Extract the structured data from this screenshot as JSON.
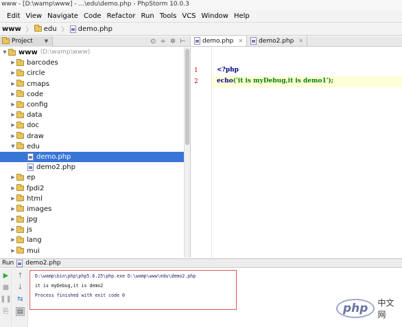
{
  "window": {
    "title": "www - [D:\\wamp\\www] - ...\\edu\\demo.php - PhpStorm 10.0.3"
  },
  "menu": [
    "Edit",
    "View",
    "Navigate",
    "Code",
    "Refactor",
    "Run",
    "Tools",
    "VCS",
    "Window",
    "Help"
  ],
  "breadcrumb": {
    "root": "www",
    "folder": "edu",
    "file": "demo.php"
  },
  "project_panel": {
    "tab_label": "Project",
    "root_label": "www",
    "root_hint": "(D:\\wamp\\www)",
    "items": [
      {
        "label": "barcodes",
        "kind": "folder",
        "state": "collapsed"
      },
      {
        "label": "circle",
        "kind": "folder",
        "state": "collapsed"
      },
      {
        "label": "cmaps",
        "kind": "folder",
        "state": "collapsed"
      },
      {
        "label": "code",
        "kind": "folder",
        "state": "collapsed"
      },
      {
        "label": "config",
        "kind": "folder",
        "state": "collapsed"
      },
      {
        "label": "data",
        "kind": "folder",
        "state": "collapsed"
      },
      {
        "label": "doc",
        "kind": "folder",
        "state": "collapsed"
      },
      {
        "label": "draw",
        "kind": "folder",
        "state": "collapsed"
      },
      {
        "label": "edu",
        "kind": "folder",
        "state": "expanded"
      },
      {
        "label": "demo.php",
        "kind": "php",
        "state": "selected"
      },
      {
        "label": "demo2.php",
        "kind": "php",
        "state": ""
      },
      {
        "label": "ep",
        "kind": "folder",
        "state": "collapsed"
      },
      {
        "label": "fpdi2",
        "kind": "folder",
        "state": "collapsed"
      },
      {
        "label": "html",
        "kind": "folder",
        "state": "collapsed"
      },
      {
        "label": "images",
        "kind": "folder",
        "state": "collapsed"
      },
      {
        "label": "jpg",
        "kind": "folder",
        "state": "collapsed"
      },
      {
        "label": "js",
        "kind": "folder",
        "state": "collapsed"
      },
      {
        "label": "lang",
        "kind": "folder",
        "state": "collapsed"
      },
      {
        "label": "mui",
        "kind": "folder",
        "state": "collapsed"
      }
    ]
  },
  "editor": {
    "tabs": [
      {
        "label": "demo.php",
        "active": true
      },
      {
        "label": "demo2.php",
        "active": false
      }
    ],
    "lines": [
      {
        "num": "1",
        "open_tag": "<?php"
      },
      {
        "num": "2",
        "keyword": "echo",
        "string": "('it is myDebug,it is demo1');"
      }
    ]
  },
  "run_panel": {
    "label": "Run",
    "tab_label": "demo2.php",
    "output": [
      "D:\\wamp\\bin\\php\\php5.6.25\\php.exe D:\\wamp\\www\\edu\\demo2.php",
      "it is myDebug,it is demo2",
      "Process finished with exit code 0"
    ]
  },
  "watermark": {
    "logo": "php",
    "text": "中文网"
  },
  "colors": {
    "selection": "#3875d7",
    "keyword": "#000080",
    "string": "#008000",
    "highlight_line": "#ffffd7",
    "console_border": "#e15050"
  }
}
